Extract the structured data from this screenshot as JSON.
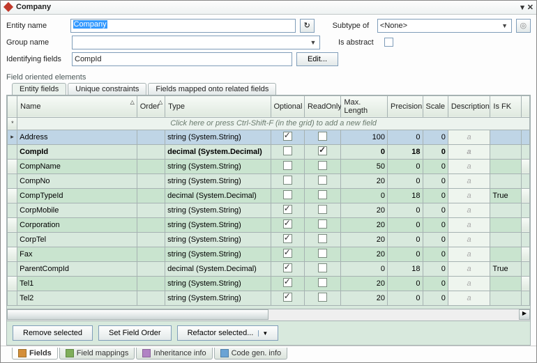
{
  "window": {
    "title": "Company"
  },
  "form": {
    "entity_name_label": "Entity name",
    "entity_name_value": "Company",
    "refresh_icon": "↻",
    "subtype_label": "Subtype of",
    "subtype_value": "<None>",
    "group_name_label": "Group name",
    "group_name_value": "",
    "is_abstract_label": "Is abstract",
    "identifying_fields_label": "Identifying fields",
    "identifying_fields_value": "CompId",
    "edit_btn": "Edit..."
  },
  "section_title": "Field oriented elements",
  "tabs_top": [
    "Entity fields",
    "Unique constraints",
    "Fields mapped onto related fields"
  ],
  "tabs_top_active": 0,
  "grid": {
    "cols": [
      "Name",
      "Order",
      "Type",
      "Optional",
      "ReadOnly",
      "Max. Length",
      "Precision",
      "Scale",
      "Description",
      "Is FK"
    ],
    "new_row_hint": "Click here or press Ctrl-Shift-F (in the grid) to add a new field",
    "rows": [
      {
        "name": "Address",
        "type": "string (System.String)",
        "optional": true,
        "readonly": false,
        "maxlen": "100",
        "precision": "0",
        "scale": "0",
        "isfk": "",
        "selected": true
      },
      {
        "name": "CompId",
        "type": "decimal (System.Decimal)",
        "optional": false,
        "readonly": true,
        "maxlen": "0",
        "precision": "18",
        "scale": "0",
        "isfk": "",
        "bold": true
      },
      {
        "name": "CompName",
        "type": "string (System.String)",
        "optional": false,
        "readonly": false,
        "maxlen": "50",
        "precision": "0",
        "scale": "0",
        "isfk": ""
      },
      {
        "name": "CompNo",
        "type": "string (System.String)",
        "optional": false,
        "readonly": false,
        "maxlen": "20",
        "precision": "0",
        "scale": "0",
        "isfk": ""
      },
      {
        "name": "CompTypeId",
        "type": "decimal (System.Decimal)",
        "optional": false,
        "readonly": false,
        "maxlen": "0",
        "precision": "18",
        "scale": "0",
        "isfk": "True"
      },
      {
        "name": "CorpMobile",
        "type": "string (System.String)",
        "optional": true,
        "readonly": false,
        "maxlen": "20",
        "precision": "0",
        "scale": "0",
        "isfk": ""
      },
      {
        "name": "Corporation",
        "type": "string (System.String)",
        "optional": true,
        "readonly": false,
        "maxlen": "20",
        "precision": "0",
        "scale": "0",
        "isfk": ""
      },
      {
        "name": "CorpTel",
        "type": "string (System.String)",
        "optional": true,
        "readonly": false,
        "maxlen": "20",
        "precision": "0",
        "scale": "0",
        "isfk": ""
      },
      {
        "name": "Fax",
        "type": "string (System.String)",
        "optional": true,
        "readonly": false,
        "maxlen": "20",
        "precision": "0",
        "scale": "0",
        "isfk": ""
      },
      {
        "name": "ParentCompId",
        "type": "decimal (System.Decimal)",
        "optional": true,
        "readonly": false,
        "maxlen": "0",
        "precision": "18",
        "scale": "0",
        "isfk": "True"
      },
      {
        "name": "Tel1",
        "type": "string (System.String)",
        "optional": true,
        "readonly": false,
        "maxlen": "20",
        "precision": "0",
        "scale": "0",
        "isfk": ""
      },
      {
        "name": "Tel2",
        "type": "string (System.String)",
        "optional": true,
        "readonly": false,
        "maxlen": "20",
        "precision": "0",
        "scale": "0",
        "isfk": ""
      }
    ]
  },
  "buttons": {
    "remove": "Remove selected",
    "setorder": "Set Field Order",
    "refactor": "Refactor selected..."
  },
  "tabs_bottom": [
    "Fields",
    "Field mappings",
    "Inheritance info",
    "Code gen. info"
  ],
  "tabs_bottom_active": 0
}
